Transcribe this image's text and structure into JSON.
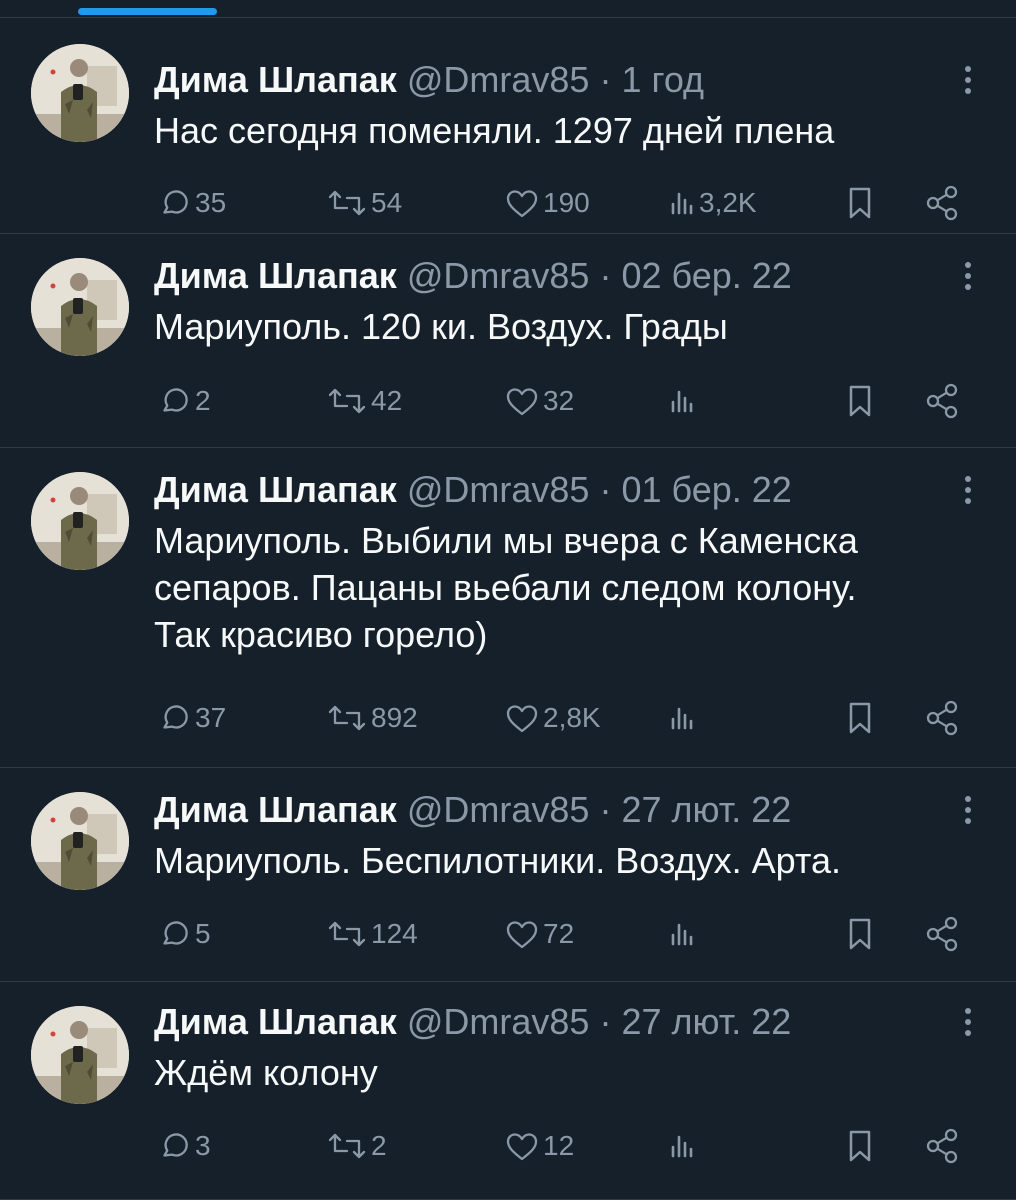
{
  "colors": {
    "background": "#15202b",
    "text": "#f7f9f9",
    "secondary": "#8b98a5",
    "divider": "#2f3a44",
    "accent": "#1d9bf0"
  },
  "icons": {
    "reply": "reply-icon",
    "retweet": "retweet-icon",
    "like": "heart-icon",
    "views": "views-icon",
    "bookmark": "bookmark-icon",
    "share": "share-icon",
    "more": "more-icon"
  },
  "tweets": [
    {
      "author": "Дима Шлапак",
      "handle": "@Dmrav85",
      "separator": "·",
      "time": "1 год",
      "lines": [
        "Нас сегодня поменяли. 1297 дней плена"
      ],
      "replies": "35",
      "retweets": "54",
      "likes": "190",
      "views": "3,2K"
    },
    {
      "author": "Дима Шлапак",
      "handle": "@Dmrav85",
      "separator": "·",
      "time": "02 бер. 22",
      "lines": [
        "Мариуполь. 120 ки. Воздух. Грады"
      ],
      "replies": "2",
      "retweets": "42",
      "likes": "32",
      "views": ""
    },
    {
      "author": "Дима Шлапак",
      "handle": "@Dmrav85",
      "separator": "·",
      "time": "01 бер. 22",
      "lines": [
        "Мариуполь. Выбили мы вчера с Каменска",
        "сепаров. Пацаны вьебали следом колону.",
        "Так красиво горело)"
      ],
      "replies": "37",
      "retweets": "892",
      "likes": "2,8K",
      "views": ""
    },
    {
      "author": "Дима Шлапак",
      "handle": "@Dmrav85",
      "separator": "·",
      "time": "27 лют. 22",
      "lines": [
        "Мариуполь. Беспилотники. Воздух. Арта."
      ],
      "replies": "5",
      "retweets": "124",
      "likes": "72",
      "views": ""
    },
    {
      "author": "Дима Шлапак",
      "handle": "@Dmrav85",
      "separator": "·",
      "time": "27 лют. 22",
      "lines": [
        "Ждём колону"
      ],
      "replies": "3",
      "retweets": "2",
      "likes": "12",
      "views": ""
    }
  ]
}
